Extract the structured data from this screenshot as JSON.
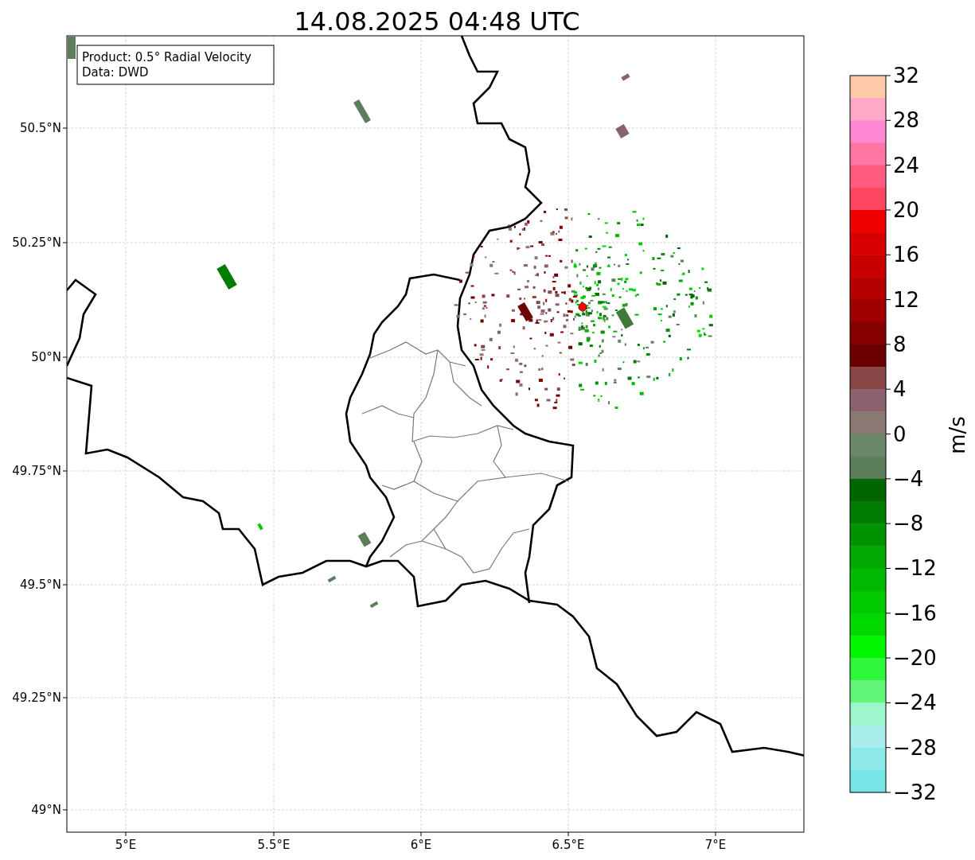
{
  "title": "14.08.2025 04:48 UTC",
  "legend": {
    "lines": [
      "Product: 0.5° Radial Velocity",
      "Data: DWD"
    ]
  },
  "map": {
    "x_ticks": [
      "5°E",
      "5.5°E",
      "6°E",
      "6.5°E",
      "7°E"
    ],
    "y_ticks": [
      "50.5°N",
      "50.25°N",
      "50°N",
      "49.75°N",
      "49.5°N",
      "49.25°N",
      "49°N"
    ]
  },
  "colorbar": {
    "label": "m/s",
    "ticks": [
      "32",
      "28",
      "24",
      "20",
      "16",
      "12",
      "8",
      "4",
      "0",
      "−4",
      "−8",
      "−12",
      "−16",
      "−20",
      "−24",
      "−28",
      "−32"
    ],
    "segments": [
      {
        "color": "#ffcaaa"
      },
      {
        "color": "#ffa8c8"
      },
      {
        "color": "#ff86d0"
      },
      {
        "color": "#ff76a4"
      },
      {
        "color": "#ff5a80"
      },
      {
        "color": "#ff4660"
      },
      {
        "color": "#f20000"
      },
      {
        "color": "#d80000"
      },
      {
        "color": "#c90000"
      },
      {
        "color": "#b70000"
      },
      {
        "color": "#9e0000"
      },
      {
        "color": "#870000"
      },
      {
        "color": "#6b0000"
      },
      {
        "color": "#874747"
      },
      {
        "color": "#89626e"
      },
      {
        "color": "#8a7973"
      },
      {
        "color": "#6b876a"
      },
      {
        "color": "#5d7e5b"
      },
      {
        "color": "#006700"
      },
      {
        "color": "#007d00"
      },
      {
        "color": "#009300"
      },
      {
        "color": "#00a800"
      },
      {
        "color": "#00b800"
      },
      {
        "color": "#00c900"
      },
      {
        "color": "#00d800"
      },
      {
        "color": "#00f700"
      },
      {
        "color": "#2ef83a"
      },
      {
        "color": "#63f77a"
      },
      {
        "color": "#9ff5cc"
      },
      {
        "color": "#a8ecec"
      },
      {
        "color": "#8de9ea"
      },
      {
        "color": "#76e5e7"
      }
    ]
  }
}
